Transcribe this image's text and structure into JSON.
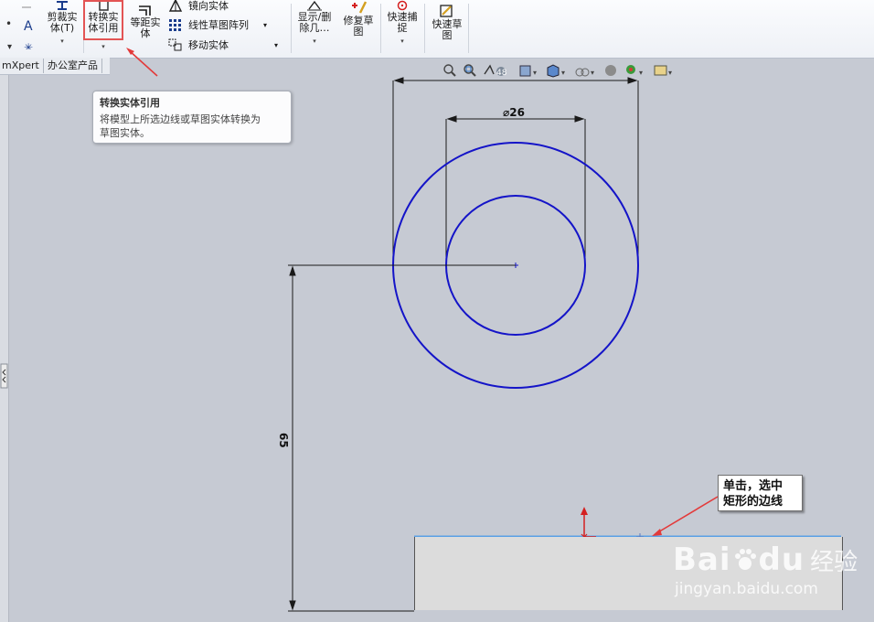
{
  "ribbon": {
    "trim_label_1": "剪裁实",
    "trim_label_2": "体(T)",
    "convert_label_1": "转换实",
    "convert_label_2": "体引用",
    "offset_label_1": "等距实",
    "offset_label_2": "体",
    "mirror_label": "镜向实体",
    "linear_pattern_label": "线性草图阵列",
    "move_label": "移动实体",
    "show_delete_label_1": "显示/删",
    "show_delete_label_2": "除几…",
    "repair_label_1": "修复草",
    "repair_label_2": "图",
    "quick_snap_label_1": "快速捕",
    "quick_snap_label_2": "捉",
    "rapid_sketch_label_1": "快速草",
    "rapid_sketch_label_2": "图"
  },
  "tabs": {
    "simxpert": "mXpert",
    "office": "办公室产品"
  },
  "tooltip": {
    "title": "转换实体引用",
    "desc_1": "将模型上所选边线或草图实体转换为",
    "desc_2": "草图实体。"
  },
  "dimensions": {
    "inner_diameter": "⌀26",
    "vertical": "65"
  },
  "note": {
    "line1": "单击，选中",
    "line2": "矩形的边线"
  },
  "watermark": {
    "brand": "Bai",
    "brand2": "du",
    "cn": "经验",
    "url": "jingyan.baidu.com"
  },
  "colors": {
    "sketch_blue": "#1414c8",
    "highlight_red": "#e35454",
    "selected_edge": "#5aa0e6"
  }
}
